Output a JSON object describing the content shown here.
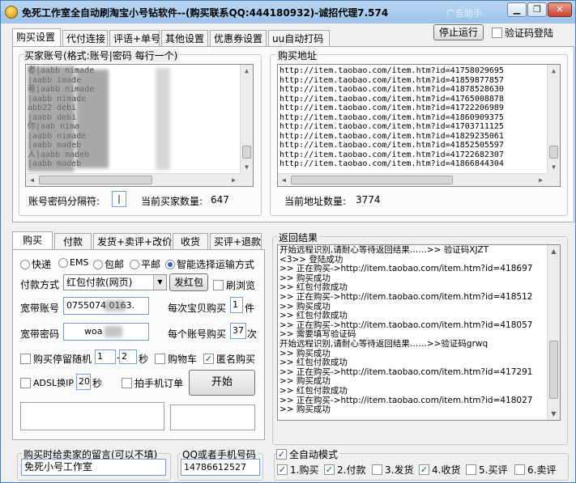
{
  "window": {
    "title": "免死工作室全自动刷淘宝小号钻软件--(购买联系QQ:444180932)-诚招代理7.574",
    "watermark": "广告助手",
    "min": "▁",
    "max": "❐",
    "close": "✕"
  },
  "top_tabs": [
    "购买设置",
    "代付连接",
    "评语+单号",
    "其他设置",
    "优惠券设置",
    "uu自动打码"
  ],
  "top_right": {
    "stop_label": "停止运行",
    "verify_login_label": "验证码登陆"
  },
  "accounts": {
    "group_label": "买家账号(格式:账号|密码 每行一个)",
    "lines": [
      "者|aabb     nimade",
      "|aabb      imade",
      "着|aabb     nimade",
      "|aabb      nimade",
      "abb22      debi",
      "|aabb      debi",
      "你|aab     nima",
      "|aabb      nimade",
      "|aabb      madeb",
      "人|aabb    madeb",
      "|aabb      madeb"
    ],
    "sep_label": "账号密码分隔符:",
    "sep_value": "|",
    "count_label": "当前买家数量:",
    "count": "647"
  },
  "urls": {
    "group_label": "购买地址",
    "lines": [
      "http://item.taobao.com/item.htm?id=41758029695",
      "http://item.taobao.com/item.htm?id=41859877857",
      "http://item.taobao.com/item.htm?id=41878528630",
      "http://item.taobao.com/item.htm?id=41765008878",
      "http://item.taobao.com/item.htm?id=41722206989",
      "http://item.taobao.com/item.htm?id=41860909375",
      "http://item.taobao.com/item.htm?id=41703711125",
      "http://item.taobao.com/item.htm?id=41829235061",
      "http://item.taobao.com/item.htm?id=41852505597",
      "http://item.taobao.com/item.htm?id=41722682307",
      "http://item.taobao.com/item.htm?id=41866844304"
    ],
    "count_label": "当前地址数量:",
    "count": "3774"
  },
  "buy_tabs": [
    "购买",
    "付款",
    "发货+卖评+改价",
    "收货",
    "买评+退款"
  ],
  "buy": {
    "shipping": [
      "快递",
      "EMS",
      "包邮",
      "平邮",
      "智能选择运输方式"
    ],
    "pay_label": "付款方式",
    "pay_value": "红包付款(网页)",
    "red_packet_btn": "发红包",
    "browse_label": "刷浏览",
    "broadband_acc_label": "宽带账号",
    "broadband_acc": "0755074      0163.",
    "per_item_label": "每次宝贝购买",
    "per_item_value": "1",
    "per_item_unit": "件",
    "broadband_pwd_label": "宽带密码",
    "broadband_pwd": "woa",
    "per_account_label": "每个账号购买",
    "per_account_value": "37",
    "per_account_unit": "次",
    "random_stay_label": "购买停留随机",
    "random_min": "1",
    "dash": "-",
    "random_max": "2",
    "random_unit": "秒",
    "cart_label": "购物车",
    "anon_label": "匿名购买",
    "adsl_label": "ADSL换IP",
    "adsl_value": "20",
    "adsl_unit": "秒",
    "mobile_label": "拍手机订单",
    "start_label": "开始"
  },
  "results": {
    "group_label": "返回结果",
    "lines": [
      "开始远程识别,请耐心等待返回结果……>> 验证码XJZT",
      "          <3>> 登陆成功",
      ">> 正在购买->http://item.taobao.com/item.htm?id=418697",
      ">> 购买成功",
      ">> 红包付款成功",
      ">> 正在购买->http://item.taobao.com/item.htm?id=418512",
      ">> 购买成功",
      ">> 红包付款成功",
      ">> 正在购买->http://item.taobao.com/item.htm?id=418057",
      ">> 需要填写验证码",
      "开始远程识别,请耐心等待返回结果……>>验证码grwq",
      ">> 购买成功",
      ">> 红包付款成功",
      ">> 正在购买->http://item.taobao.com/item.htm?id=417291",
      ">> 购买成功",
      ">> 红包付款成功",
      ">> 正在购买->http://item.taobao.com/item.htm?id=418027",
      ">> 购买成功"
    ]
  },
  "message": {
    "group_label": "购买时给卖家的留言(可以不填)",
    "value": "免死小号工作室"
  },
  "qq": {
    "group_label": "QQ或者手机号码",
    "value": "14786612527"
  },
  "auto": {
    "label": "全自动模式",
    "items": [
      {
        "label": "1.购买",
        "checked": true
      },
      {
        "label": "2.付款",
        "checked": true
      },
      {
        "label": "3.发货",
        "checked": false
      },
      {
        "label": "4.收货",
        "checked": true
      },
      {
        "label": "5.买评",
        "checked": false
      },
      {
        "label": "6.卖评",
        "checked": false
      }
    ]
  },
  "check_mark": "✓"
}
